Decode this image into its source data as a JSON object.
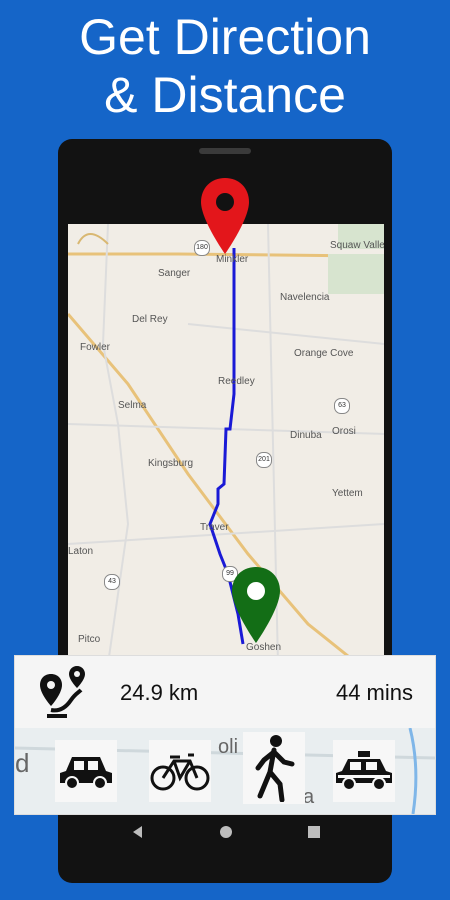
{
  "headline": {
    "line1": "Get Direction",
    "line2": "& Distance"
  },
  "map": {
    "places": [
      {
        "name": "Sanger"
      },
      {
        "name": "Del Rey"
      },
      {
        "name": "Fowler"
      },
      {
        "name": "Selma"
      },
      {
        "name": "Kingsburg"
      },
      {
        "name": "Laton"
      },
      {
        "name": "Pitco"
      },
      {
        "name": "Reedley"
      },
      {
        "name": "Dinuba"
      },
      {
        "name": "Traver"
      },
      {
        "name": "Navelencia"
      },
      {
        "name": "Orange Cove"
      },
      {
        "name": "Orosi"
      },
      {
        "name": "Yettem"
      },
      {
        "name": "Squaw Valley"
      },
      {
        "name": "Minkler"
      },
      {
        "name": "Goshen"
      }
    ],
    "highways": [
      "180",
      "63",
      "201",
      "99",
      "43"
    ],
    "start_marker": "pin-red",
    "end_marker": "pin-green",
    "route_color": "#1a1ad6",
    "behind_text": [
      "d",
      "oli",
      "a"
    ]
  },
  "route": {
    "distance": "24.9 km",
    "duration": "44 mins",
    "icon": "route-pins-icon"
  },
  "modes": [
    {
      "name": "car",
      "icon": "car-icon"
    },
    {
      "name": "bicycle",
      "icon": "bicycle-icon"
    },
    {
      "name": "walking",
      "icon": "walking-icon"
    },
    {
      "name": "taxi",
      "icon": "taxi-icon"
    }
  ],
  "navbar": [
    "back-icon",
    "home-icon",
    "recents-icon"
  ],
  "colors": {
    "background": "#1565c8",
    "start_pin": "#e3161b",
    "end_pin": "#136e16"
  }
}
